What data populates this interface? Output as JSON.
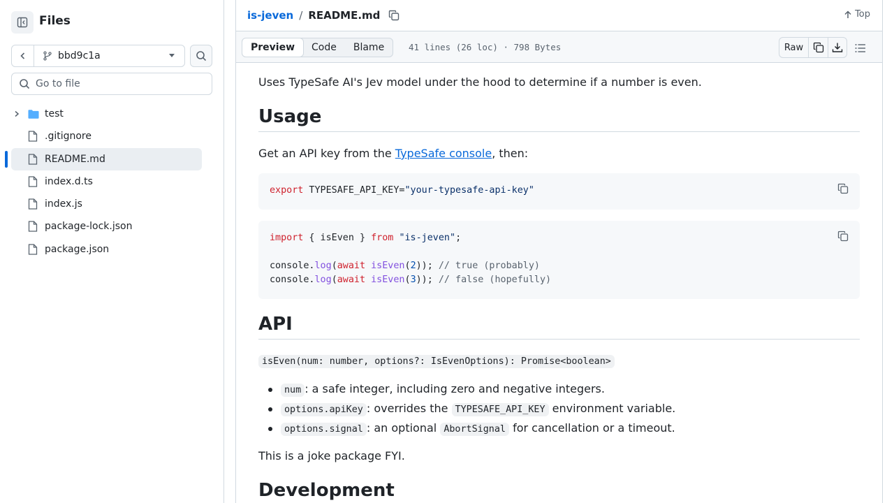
{
  "sidebar": {
    "title": "Files",
    "branch": "bbd9c1a",
    "search_placeholder": "Go to file",
    "items": [
      {
        "label": "test",
        "type": "folder"
      },
      {
        "label": ".gitignore",
        "type": "file"
      },
      {
        "label": "README.md",
        "type": "file",
        "selected": true
      },
      {
        "label": "index.d.ts",
        "type": "file"
      },
      {
        "label": "index.js",
        "type": "file"
      },
      {
        "label": "package-lock.json",
        "type": "file"
      },
      {
        "label": "package.json",
        "type": "file"
      }
    ]
  },
  "header": {
    "repo": "is-jeven",
    "separator": "/",
    "file": "README.md",
    "top_label": "Top"
  },
  "toolbar": {
    "tabs": [
      "Preview",
      "Code",
      "Blame"
    ],
    "active_tab": "Preview",
    "meta": "41 lines (26 loc) · 798 Bytes",
    "raw_label": "Raw"
  },
  "readme": {
    "intro": "Uses TypeSafe AI's Jev model under the hood to determine if a number is even.",
    "usage_heading": "Usage",
    "usage_text_before": "Get an API key from the ",
    "usage_link": "TypeSafe console",
    "usage_text_after": ", then:",
    "code1": {
      "kw": "export",
      "var": " TYPESAFE_API_KEY=",
      "str": "\"your-typesafe-api-key\""
    },
    "code2": {
      "l1_kw1": "import",
      "l1_mid": " { isEven } ",
      "l1_kw2": "from",
      "l1_str": "\"is-jeven\"",
      "l1_end": ";",
      "l2_a": "console.",
      "l2_fn": "log",
      "l2_b": "(",
      "l2_kw": "await",
      "l2_fn2": "isEven",
      "l2_c": "(",
      "l2_num": "2",
      "l2_d": ")); ",
      "l2_cm": "// true (probably)",
      "l3_num": "3",
      "l3_cm": "// false (hopefully)"
    },
    "api_heading": "API",
    "signature": "isEven(num: number, options?: IsEvenOptions): Promise<boolean>",
    "bullets": [
      {
        "code": "num",
        "text": ": a safe integer, including zero and negative integers."
      },
      {
        "code": "options.apiKey",
        "text_before": ": overrides the ",
        "code2": "TYPESAFE_API_KEY",
        "text_after": " environment variable."
      },
      {
        "code": "options.signal",
        "text_before": ": an optional ",
        "code2": "AbortSignal",
        "text_after": " for cancellation or a timeout."
      }
    ],
    "joke": "This is a joke package FYI.",
    "dev_heading": "Development"
  },
  "colors": {
    "accent": "#0969da",
    "keyword": "#cf222e",
    "string": "#0a3069",
    "function": "#8250df",
    "comment": "#59636e",
    "folder": "#54aeff"
  }
}
